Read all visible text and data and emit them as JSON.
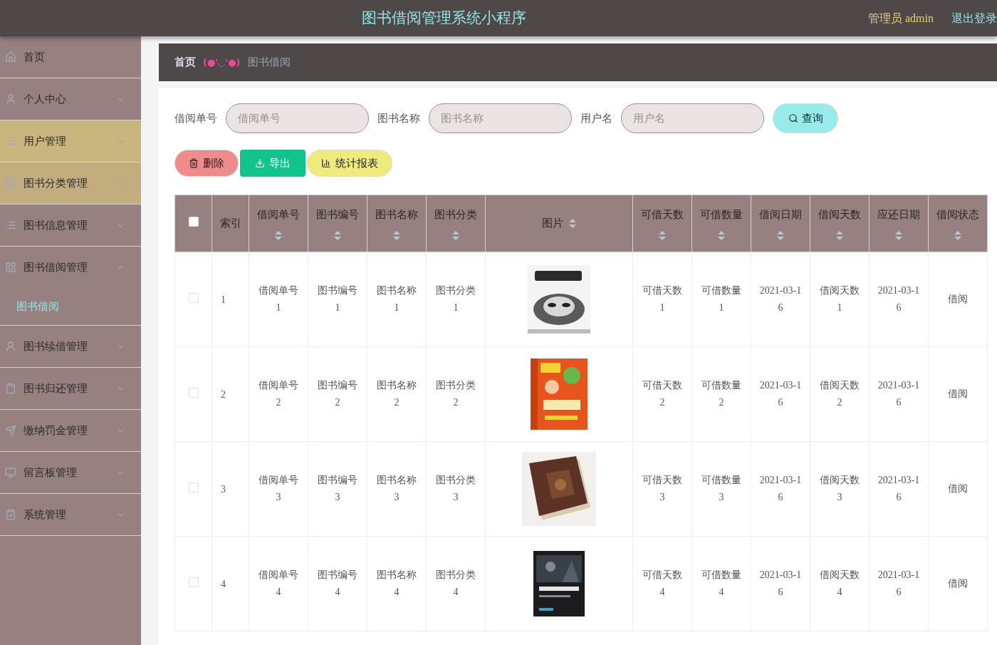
{
  "header": {
    "title": "图书借阅管理系统小程序",
    "user": "管理员 admin",
    "logout": "退出登录"
  },
  "sidebar": {
    "items": [
      {
        "label": "首页",
        "kind": "link",
        "highlighted": false
      },
      {
        "label": "个人中心",
        "kind": "menu",
        "highlighted": false,
        "expanded": false
      },
      {
        "label": "用户管理",
        "kind": "menu",
        "highlighted": true,
        "expanded": false
      },
      {
        "label": "图书分类管理",
        "kind": "menu",
        "highlighted": true,
        "expanded": false
      },
      {
        "label": "图书信息管理",
        "kind": "menu",
        "highlighted": false,
        "expanded": false
      },
      {
        "label": "图书借阅管理",
        "kind": "menu",
        "highlighted": false,
        "expanded": true,
        "children": [
          {
            "label": "图书借阅",
            "selected": true
          }
        ]
      },
      {
        "label": "图书续借管理",
        "kind": "menu",
        "highlighted": false,
        "expanded": false
      },
      {
        "label": "图书归还管理",
        "kind": "menu",
        "highlighted": false,
        "expanded": false
      },
      {
        "label": "缴纳罚金管理",
        "kind": "menu",
        "highlighted": false,
        "expanded": false
      },
      {
        "label": "留言板管理",
        "kind": "menu",
        "highlighted": false,
        "expanded": false
      },
      {
        "label": "系统管理",
        "kind": "menu",
        "highlighted": false,
        "expanded": false
      }
    ]
  },
  "breadcrumb": {
    "home": "首页",
    "separator": "(●'◡'●)",
    "current": "图书借阅"
  },
  "search": {
    "fields": [
      {
        "label": "借阅单号",
        "placeholder": "借阅单号"
      },
      {
        "label": "图书名称",
        "placeholder": "图书名称"
      },
      {
        "label": "用户名",
        "placeholder": "用户名"
      }
    ],
    "button": "查询"
  },
  "actions": [
    {
      "label": "删除",
      "kind": "delete"
    },
    {
      "label": "导出",
      "kind": "export"
    },
    {
      "label": "统计报表",
      "kind": "report"
    }
  ],
  "table": {
    "columns": [
      {
        "kind": "checkbox",
        "checked": false
      },
      {
        "kind": "text",
        "label": "索引"
      },
      {
        "kind": "sortable",
        "label": "借阅单号"
      },
      {
        "kind": "sortable",
        "label": "图书编号"
      },
      {
        "kind": "sortable",
        "label": "图书名称"
      },
      {
        "kind": "sortable",
        "label": "图书分类"
      },
      {
        "kind": "picture",
        "label": "图片"
      },
      {
        "kind": "sortable",
        "label": "可借天数"
      },
      {
        "kind": "sortable",
        "label": "可借数量"
      },
      {
        "kind": "sortable",
        "label": "借阅日期"
      },
      {
        "kind": "sortable",
        "label": "借阅天数"
      },
      {
        "kind": "sortable",
        "label": "应还日期"
      },
      {
        "kind": "sortable",
        "label": "借阅状态"
      }
    ],
    "rows": [
      {
        "cells": [
          {
            "kind": "checkbox",
            "checked": false
          },
          "1",
          "借阅单号1",
          "图书编号1",
          "图书名称1",
          "图书分类1",
          {
            "kind": "picture"
          },
          "可借天数1",
          "可借数量1",
          "2021-03-16",
          "借阅天数1",
          "2021-03-16",
          "借阅"
        ]
      },
      {
        "cells": [
          {
            "kind": "checkbox",
            "checked": false
          },
          "2",
          "借阅单号2",
          "图书编号2",
          "图书名称2",
          "图书分类2",
          {
            "kind": "picture"
          },
          "可借天数2",
          "可借数量2",
          "2021-03-16",
          "借阅天数2",
          "2021-03-16",
          "借阅"
        ]
      },
      {
        "cells": [
          {
            "kind": "checkbox",
            "checked": false
          },
          "3",
          "借阅单号3",
          "图书编号3",
          "图书名称3",
          "图书分类3",
          {
            "kind": "picture"
          },
          "可借天数3",
          "可借数量3",
          "2021-03-16",
          "借阅天数3",
          "2021-03-16",
          "借阅"
        ]
      },
      {
        "cells": [
          {
            "kind": "checkbox",
            "checked": false
          },
          "4",
          "借阅单号4",
          "图书编号4",
          "图书名称4",
          "图书分类4",
          {
            "kind": "picture"
          },
          "可借天数4",
          "可借数量4",
          "2021-03-16",
          "借阅天数4",
          "2021-03-16",
          "借阅"
        ]
      }
    ]
  }
}
